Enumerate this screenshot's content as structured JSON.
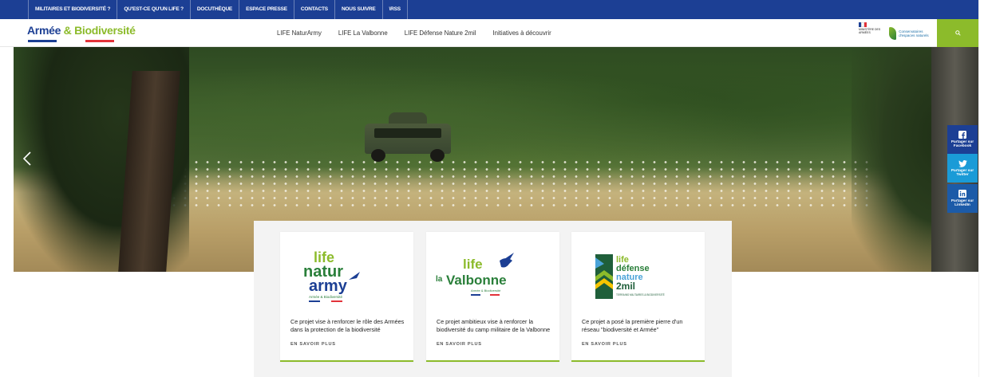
{
  "topbar": {
    "links": [
      "MILITAIRES ET BIODIVERSITÉ ?",
      "QU'EST-CE QU'UN LIFE ?",
      "DOCUTHÈQUE",
      "ESPACE PRESSE",
      "CONTACTS",
      "NOUS SUIVRE",
      "RSS"
    ]
  },
  "header": {
    "logo_part1": "Armée ",
    "logo_part2": "& Biodiversité",
    "nav": [
      "LIFE NaturArmy",
      "LIFE La Valbonne",
      "LIFE Défense Nature 2mil",
      "Initiatives à découvrir"
    ],
    "gov_logo_text": "MINISTÈRE DES ARMÉES",
    "cen_logo_text": "Conservatoires d'espaces naturels",
    "search_icon": "search-icon"
  },
  "hero": {
    "prev_icon": "chevron-left-icon"
  },
  "share": {
    "facebook": "Partager sur Facebook",
    "twitter": "Partager sur Twitter",
    "linkedin": "Partager sur LinkedIn"
  },
  "cards": [
    {
      "logo_lines": [
        "life",
        "natur",
        "army"
      ],
      "logo_tagline": "Armée & Biodiversité",
      "desc": "Ce projet vise à renforcer le rôle des Armées dans la protection de la biodiversité",
      "more": "EN SAVOIR PLUS"
    },
    {
      "logo_lines": [
        "life",
        "la",
        "Valbonne"
      ],
      "logo_tagline": "Armée & Biodiversité",
      "desc": "Ce projet ambitieux vise à renforcer la biodiversité du camp militaire de la Valbonne",
      "more": "EN SAVOIR PLUS"
    },
    {
      "logo_lines": [
        "life",
        "défense",
        "nature",
        "2mil"
      ],
      "logo_tagline": "TERRAINS MILITAIRES & BIODIVERSITÉ",
      "desc": "Ce projet a posé la première pierre d'un réseau \"biodiversité et Armée\"",
      "more": "EN SAVOIR PLUS"
    }
  ],
  "colors": {
    "brand_blue": "#1c3f94",
    "brand_green": "#8cbb2b",
    "brand_red": "#e2333a"
  }
}
